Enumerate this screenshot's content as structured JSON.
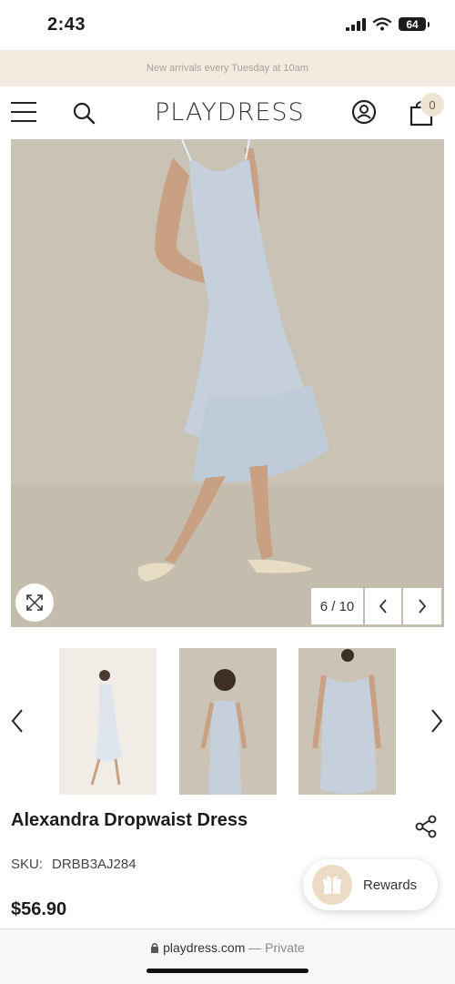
{
  "status_bar": {
    "time": "2:43",
    "battery": "64"
  },
  "announcement": {
    "text": "New arrivals every Tuesday at 10am"
  },
  "header": {
    "logo": "PLAYDRESS",
    "cart_count": "0"
  },
  "gallery": {
    "counter": "6 / 10"
  },
  "product": {
    "title": "Alexandra Dropwaist Dress",
    "sku_label": "SKU:",
    "sku_value": "DRBB3AJ284",
    "price": "$56.90"
  },
  "rewards": {
    "label": "Rewards"
  },
  "browser": {
    "domain": "playdress.com",
    "private": "— Private"
  },
  "colors": {
    "accent": "#f3ebdf",
    "dress": "#c5d0dc",
    "background_photo": "#c9c3b6"
  }
}
